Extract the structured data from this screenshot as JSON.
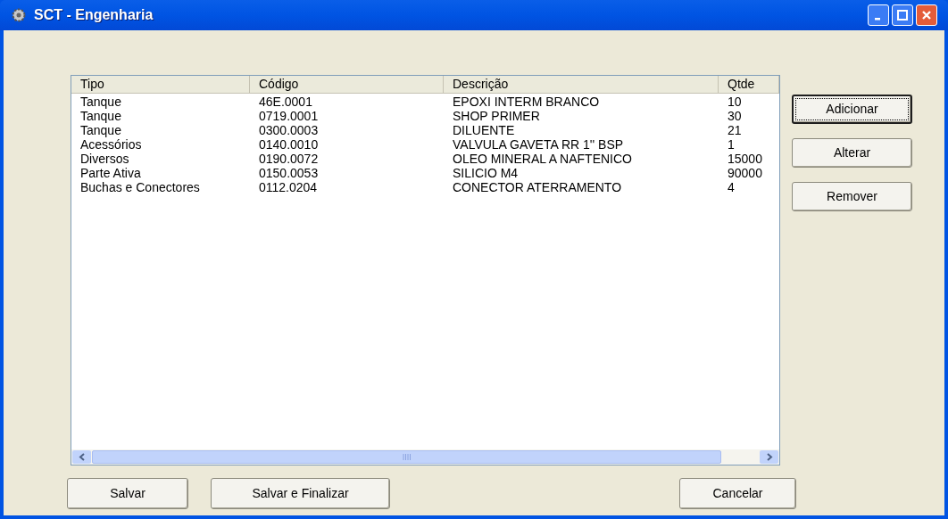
{
  "window": {
    "title": "SCT - Engenharia"
  },
  "table": {
    "columns": [
      "Tipo",
      "Código",
      "Descrição",
      "Qtde"
    ],
    "rows": [
      [
        "Tanque",
        "46E.0001",
        "EPOXI INTERM BRANCO",
        "10"
      ],
      [
        "Tanque",
        "0719.0001",
        "SHOP PRIMER",
        "30"
      ],
      [
        "Tanque",
        "0300.0003",
        "DILUENTE",
        "21"
      ],
      [
        "Acessórios",
        "0140.0010",
        "VALVULA GAVETA RR 1'' BSP",
        "1"
      ],
      [
        "Diversos",
        "0190.0072",
        "OLEO MINERAL A NAFTENICO",
        "15000"
      ],
      [
        "Parte Ativa",
        "0150.0053",
        "SILICIO M4",
        "90000"
      ],
      [
        "Buchas e Conectores",
        "0112.0204",
        "CONECTOR ATERRAMENTO",
        "4"
      ]
    ]
  },
  "side_buttons": [
    {
      "label": "Adicionar",
      "default": true
    },
    {
      "label": "Alterar",
      "default": false
    },
    {
      "label": "Remover",
      "default": false
    }
  ],
  "bottom_buttons": [
    "Salvar",
    "Salvar e Finalizar",
    "Cancelar"
  ]
}
